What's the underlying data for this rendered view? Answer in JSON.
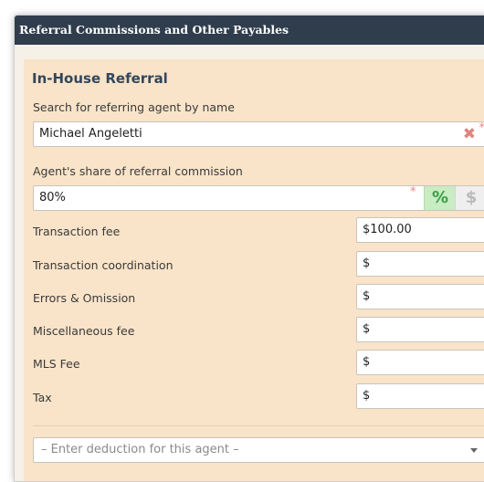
{
  "header": {
    "title": "Referral Commissions and Other Payables"
  },
  "in_house": {
    "section_title": "In-House Referral",
    "search_label": "Search for referring agent by name",
    "search_value": "Michael Angeletti",
    "share_label": "Agent's share of referral commission",
    "share_value": "80%",
    "percent_symbol": "%",
    "dollar_symbol": "$",
    "required_mark": "*",
    "clear_symbol": "✖"
  },
  "fees": [
    {
      "label": "Transaction fee",
      "value": "$100.00"
    },
    {
      "label": "Transaction coordination",
      "value": "$"
    },
    {
      "label": "Errors & Omission",
      "value": "$"
    },
    {
      "label": "Miscellaneous fee",
      "value": "$"
    },
    {
      "label": "MLS Fee",
      "value": "$"
    },
    {
      "label": "Tax",
      "value": "$"
    }
  ],
  "deduction": {
    "placeholder": "– Enter deduction for this agent –"
  }
}
